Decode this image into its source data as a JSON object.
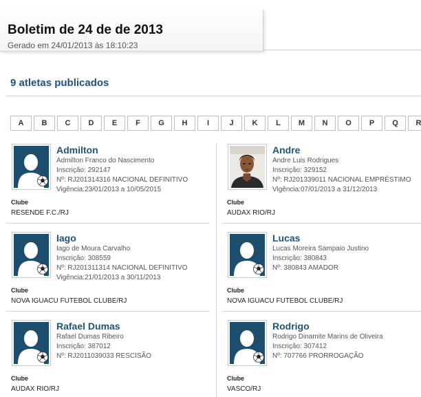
{
  "header": {
    "title": "Boletim de 24 de de 2013",
    "subtitle": "Gerado em 24/01/2013 às 18:10:23"
  },
  "count_label": "9 atletas publicados",
  "letters": [
    "A",
    "B",
    "C",
    "D",
    "E",
    "F",
    "G",
    "H",
    "I",
    "J",
    "K",
    "L",
    "M",
    "N",
    "O",
    "P",
    "Q",
    "R"
  ],
  "club_label": "Clube",
  "athletes": [
    {
      "name": "Admilton",
      "full_name": "Admilton Franco do Nascimento",
      "inscricao": "Inscrição: 292147",
      "numero": "Nº: RJ201314316 NACIONAL DEFINITIVO",
      "vigencia": "Vigência:23/01/2013 a 10/05/2015",
      "club": "RESENDE F.C./RJ",
      "photo": "placeholder"
    },
    {
      "name": "Andre",
      "full_name": "Andre Luis Rodrigues",
      "inscricao": "Inscrição: 329152",
      "numero": "Nº: RJ201339011 NACIONAL EMPRÉSTIMO",
      "vigencia": "Vigência:07/01/2013 a 31/12/2013",
      "club": "AUDAX RIO/RJ",
      "photo": "portrait"
    },
    {
      "name": "Iago",
      "full_name": "Iago de Moura Carvalho",
      "inscricao": "Inscrição: 308559",
      "numero": "Nº: RJ201311314 NACIONAL DEFINITIVO",
      "vigencia": "Vigência:21/01/2013 a 30/11/2013",
      "club": "NOVA IGUACU FUTEBOL CLUBE/RJ",
      "photo": "placeholder"
    },
    {
      "name": "Lucas",
      "full_name": "Lucas Moreira Sampaio Justino",
      "inscricao": "Inscrição: 380843",
      "numero": "Nº: 380843 AMADOR",
      "vigencia": "",
      "club": "NOVA IGUACU FUTEBOL CLUBE/RJ",
      "photo": "placeholder"
    },
    {
      "name": "Rafael Dumas",
      "full_name": "Rafael Dumas Ribeiro",
      "inscricao": "Inscrição: 387012",
      "numero": "Nº: RJ2011039033 RESCISÃO",
      "vigencia": "",
      "club": "AUDAX RIO/RJ",
      "photo": "placeholder"
    },
    {
      "name": "Rodrigo",
      "full_name": "Rodrigo Dinamite Marins de Oliveira",
      "inscricao": "Inscrição: 307412",
      "numero": "Nº: 707766 PRORROGAÇÃO",
      "vigencia": "",
      "club": "VASCO/RJ",
      "photo": "placeholder"
    }
  ],
  "colors": {
    "accent": "#1f5378",
    "placeholder_bg": "#1d4e6e",
    "border": "#d6d6d6"
  }
}
